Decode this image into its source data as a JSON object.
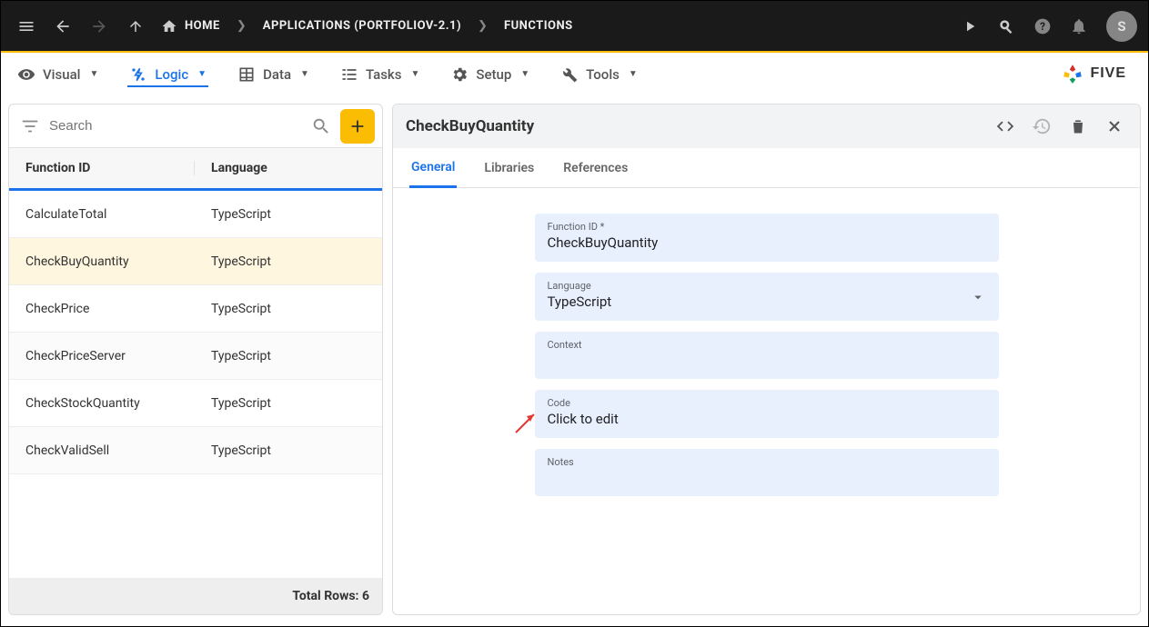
{
  "topbar": {
    "breadcrumbs": [
      {
        "label": "HOME",
        "icon": "home"
      },
      {
        "label": "APPLICATIONS (PORTFOLIOV-2.1)"
      },
      {
        "label": "FUNCTIONS"
      }
    ],
    "avatar_initial": "S"
  },
  "menubar": {
    "items": [
      {
        "label": "Visual"
      },
      {
        "label": "Logic"
      },
      {
        "label": "Data"
      },
      {
        "label": "Tasks"
      },
      {
        "label": "Setup"
      },
      {
        "label": "Tools"
      }
    ],
    "brand": "FIVE"
  },
  "left": {
    "search_placeholder": "Search",
    "col1": "Function ID",
    "col2": "Language",
    "rows": [
      {
        "id": "CalculateTotal",
        "lang": "TypeScript"
      },
      {
        "id": "CheckBuyQuantity",
        "lang": "TypeScript"
      },
      {
        "id": "CheckPrice",
        "lang": "TypeScript"
      },
      {
        "id": "CheckPriceServer",
        "lang": "TypeScript"
      },
      {
        "id": "CheckStockQuantity",
        "lang": "TypeScript"
      },
      {
        "id": "CheckValidSell",
        "lang": "TypeScript"
      }
    ],
    "selected_index": 1,
    "footer": "Total Rows: 6"
  },
  "right": {
    "title": "CheckBuyQuantity",
    "tabs": [
      "General",
      "Libraries",
      "References"
    ],
    "active_tab": 0,
    "fields": {
      "function_id_label": "Function ID *",
      "function_id_value": "CheckBuyQuantity",
      "language_label": "Language",
      "language_value": "TypeScript",
      "context_label": "Context",
      "context_value": "",
      "code_label": "Code",
      "code_value": "Click to edit",
      "notes_label": "Notes",
      "notes_value": ""
    }
  }
}
